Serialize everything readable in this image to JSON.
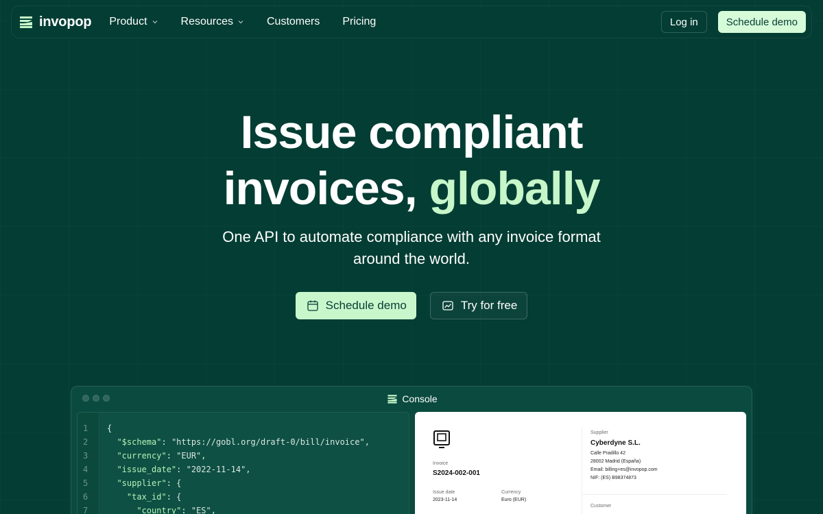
{
  "nav": {
    "logo_text": "invopop",
    "items": [
      {
        "label": "Product",
        "has_dropdown": true
      },
      {
        "label": "Resources",
        "has_dropdown": true
      },
      {
        "label": "Customers",
        "has_dropdown": false
      },
      {
        "label": "Pricing",
        "has_dropdown": false
      }
    ],
    "login_label": "Log in",
    "demo_label": "Schedule demo"
  },
  "hero": {
    "title_line1": "Issue compliant",
    "title_line2_plain": "invoices, ",
    "title_line2_accent": "globally",
    "subtitle": "One API to automate compliance with any invoice format around the world.",
    "cta_primary": "Schedule demo",
    "cta_secondary": "Try for free"
  },
  "console": {
    "title": "Console",
    "code_lines": [
      {
        "n": "1",
        "text": "{"
      },
      {
        "n": "2",
        "key": "\"$schema\"",
        "val": "\"https://gobl.org/draft-0/bill/invoice\","
      },
      {
        "n": "3",
        "key": "\"currency\"",
        "val": "\"EUR\","
      },
      {
        "n": "4",
        "key": "\"issue_date\"",
        "val": "\"2022-11-14\","
      },
      {
        "n": "5",
        "key": "\"supplier\"",
        "val": "{"
      },
      {
        "n": "6",
        "key": "\"tax_id\"",
        "val": "{"
      },
      {
        "n": "7",
        "key": "\"country\"",
        "val": "\"ES\","
      }
    ],
    "invoice": {
      "invoice_label": "Invoice",
      "invoice_number": "S2024-002-001",
      "issue_date_label": "Issue date",
      "issue_date": "2023-11-14",
      "currency_label": "Currency",
      "currency": "Euro (EUR)",
      "supplier_label": "Supplier",
      "supplier_name": "Cyberdyne S.L.",
      "supplier_address1": "Calle Pradillo 42",
      "supplier_address2": "28002 Madrid (España)",
      "supplier_email": "Email: billing+es@invopop.com",
      "supplier_nif": "NIF: (ES) B98374873",
      "customer_label": "Customer"
    }
  },
  "colors": {
    "background": "#033d33",
    "accent": "#c6f6c9",
    "button_light": "#d6fbd9"
  }
}
